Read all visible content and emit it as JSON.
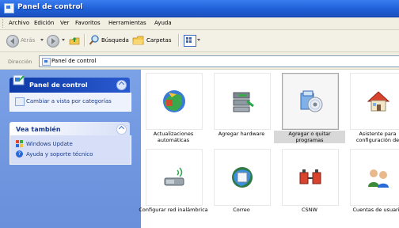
{
  "window": {
    "title": "Panel de control"
  },
  "menu": [
    "Archivo",
    "Edición",
    "Ver",
    "Favoritos",
    "Herramientas",
    "Ayuda"
  ],
  "toolbar": {
    "back": "Atrás",
    "search": "Búsqueda",
    "folders": "Carpetas"
  },
  "address": {
    "label": "Dirección",
    "value": "Panel de control"
  },
  "sidebar": {
    "panel_title": "Panel de control",
    "switch_view": "Cambiar a vista por categorías",
    "see_also_title": "Vea también",
    "see_also": [
      "Windows Update",
      "Ayuda y soporte técnico"
    ]
  },
  "items": [
    {
      "label": "Actualizaciones automáticas",
      "icon": "automatic-updates-icon"
    },
    {
      "label": "Agregar hardware",
      "icon": "add-hardware-icon"
    },
    {
      "label": "Agregar o quitar programas",
      "icon": "add-remove-programs-icon",
      "selected": true
    },
    {
      "label": "Asistente para configuración de",
      "icon": "network-setup-icon"
    },
    {
      "label": "Configurar red inalámbrica",
      "icon": "wireless-network-icon"
    },
    {
      "label": "Correo",
      "icon": "mail-icon"
    },
    {
      "label": "CSNW",
      "icon": "csnw-icon"
    },
    {
      "label": "Cuentas de usuario",
      "icon": "user-accounts-icon"
    }
  ]
}
